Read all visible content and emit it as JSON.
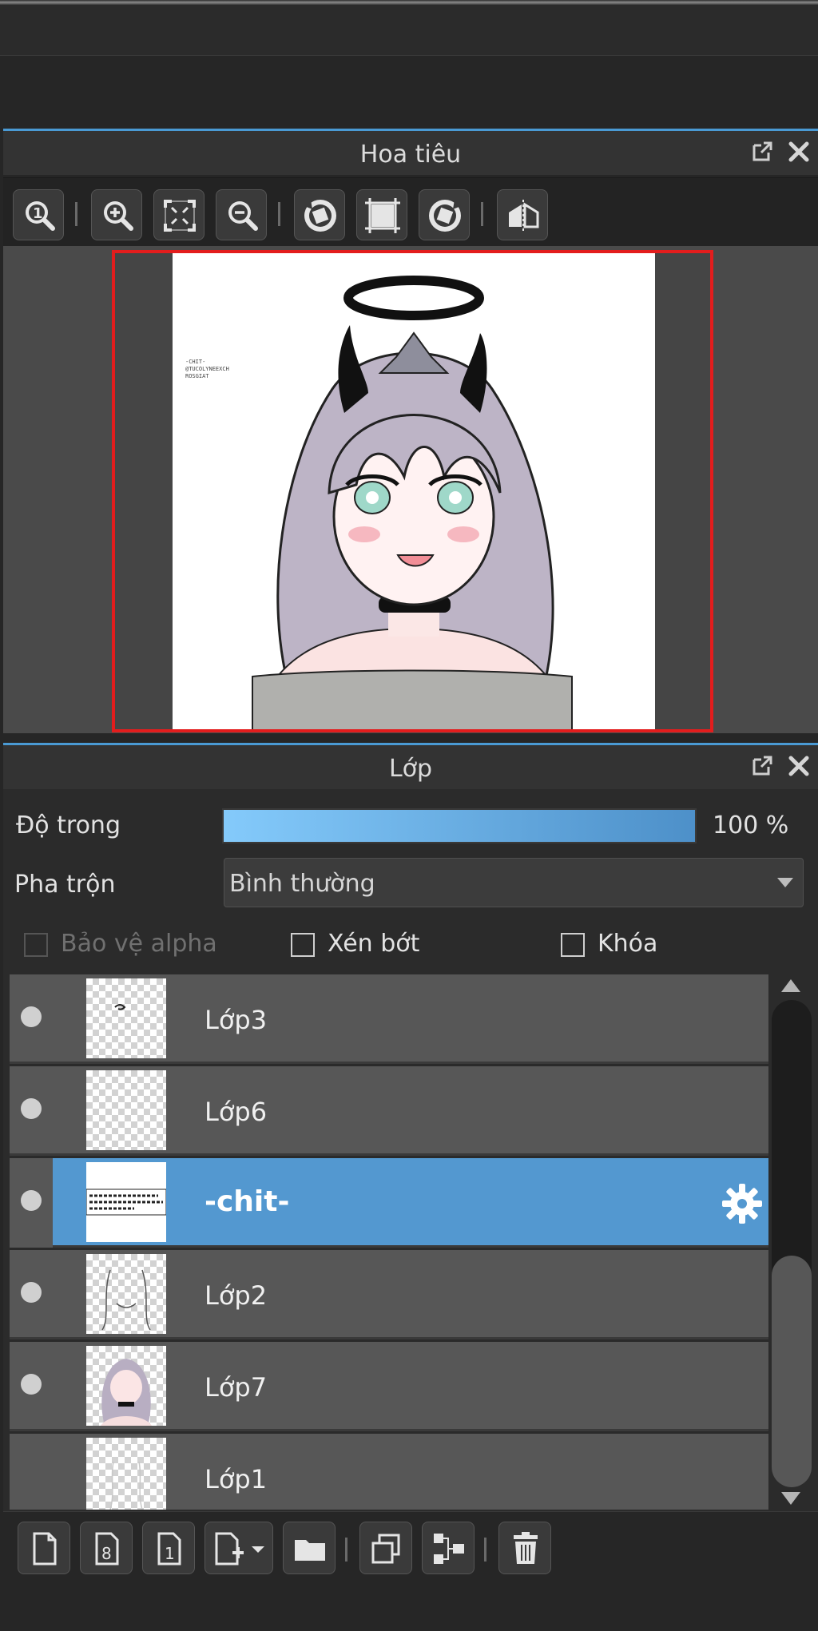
{
  "navigator": {
    "title": "Hoa tiêu",
    "tool_icons": [
      "zoom-actual-icon",
      "zoom-in-icon",
      "fit-screen-icon",
      "zoom-out-icon",
      "rotate-left-icon",
      "reset-view-icon",
      "rotate-right-icon",
      "flip-horizontal-icon"
    ]
  },
  "canvas_note": "-CHIT- @TUCOLYNEEXCH ROSGIAT",
  "layers_panel": {
    "title": "Lớp",
    "opacity_label": "Độ trong",
    "opacity_value": "100 %",
    "opacity_fraction": 1.0,
    "blend_label": "Pha trộn",
    "blend_value": "Bình thường",
    "protect_alpha_label": "Bảo vệ alpha",
    "clipping_label": "Xén bớt",
    "lock_label": "Khóa",
    "items": [
      {
        "name": "Lớp3",
        "visible": true,
        "selected": false
      },
      {
        "name": "Lớp6",
        "visible": true,
        "selected": false
      },
      {
        "name": "-chit-",
        "visible": true,
        "selected": true
      },
      {
        "name": "Lớp2",
        "visible": true,
        "selected": false
      },
      {
        "name": "Lớp7",
        "visible": true,
        "selected": false
      },
      {
        "name": "Lớp1",
        "visible": false,
        "selected": false
      }
    ]
  },
  "colors": {
    "accent": "#4a9ad4",
    "selected_layer": "#5398d0",
    "canvas_border": "#e31d1d"
  }
}
